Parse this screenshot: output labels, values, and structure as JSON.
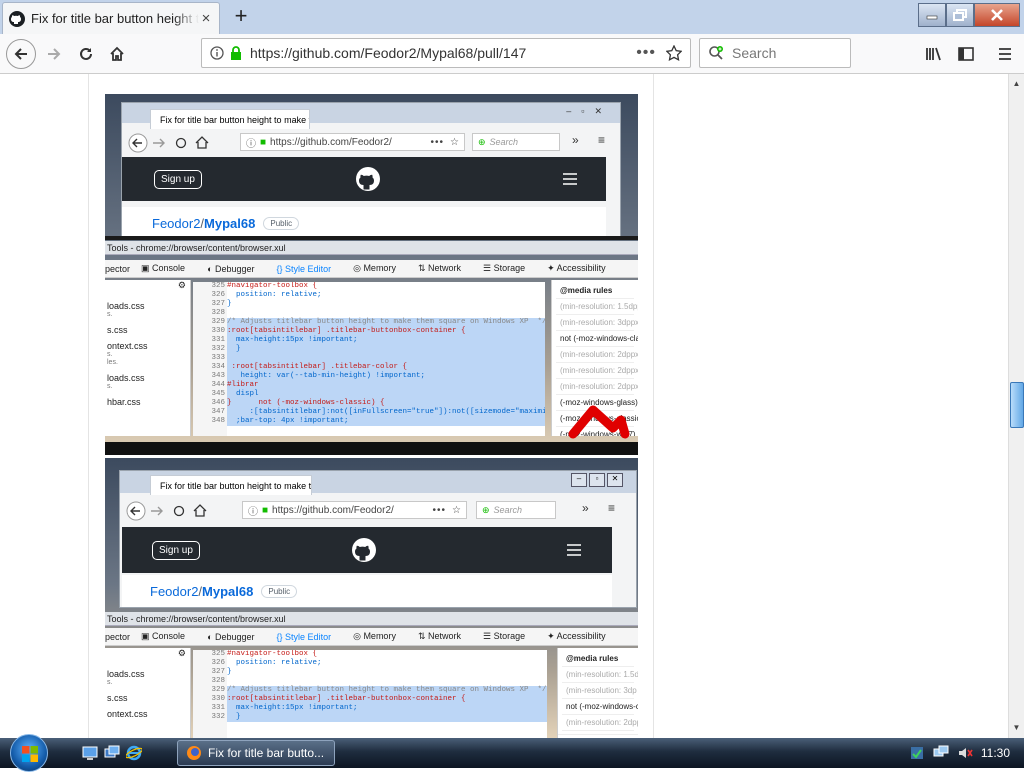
{
  "browser": {
    "tab_title": "Fix for title bar button height to make them square on Windows XP",
    "tab_close": "×",
    "new_tab": "+",
    "url": "https://github.com/Feodor2/Mypal68/pull/147",
    "page_actions": "•••",
    "search_placeholder": "Search"
  },
  "screenshot1": {
    "tab_title": "Fix for title bar button height to make them",
    "url": "https://github.com/Feodor2/",
    "search_placeholder": "Search",
    "signup": "Sign up",
    "owner": "Feodor2",
    "sep": " / ",
    "repo": "Mypal68",
    "visibility": "Public",
    "devtools_title": "Tools - chrome://browser/content/browser.xul",
    "devtools_tabs": [
      "pector",
      "Console",
      "Debugger",
      "Style Editor",
      "Memory",
      "Network",
      "Storage",
      "Accessibility"
    ],
    "files": [
      "loads.css",
      "s.",
      "s.css",
      "ontext.css",
      "s.",
      "les.",
      "loads.css",
      "s.",
      "hbar.css"
    ],
    "line_numbers": [
      "325",
      "326",
      "327",
      "328",
      "329",
      "330",
      "331",
      "332",
      "333",
      "334",
      "343",
      "344",
      "345",
      "346",
      "347",
      "348"
    ],
    "code_lines": [
      "#navigator-toolbox {",
      "  position: relative;",
      "}",
      "",
      "/* Adjusts titlebar button height to make them square on Windows XP  */",
      ":root[tabsintitlebar] .titlebar-buttonbox-container {",
      "  max-height:15px !important;",
      "  }",
      "",
      " :root[tabsintitlebar] .titlebar-color {",
      "   height: var(--tab-min-height) !important;",
      "#librar",
      "  displ",
      "}      not (-moz-windows-classic) {",
      "     :[tabsintitlebar]:not([inFullscreen=\"true\"]):not([sizemode=\"maximized",
      "  ;bar-top: 4px !important;"
    ],
    "media_rules": [
      "@media rules",
      "(min-resolution: 1.5dppx)",
      "(min-resolution: 3dppx)",
      "not (-moz-windows-classic)",
      "(min-resolution: 2dppx)",
      "(min-resolution: 2dppx)",
      "(min-resolution: 2dppx)",
      "(-moz-windows-glass),",
      "(-moz-windows-classic)",
      "(-moz-windows-win7)"
    ]
  },
  "screenshot2": {
    "tab_title": "Fix for title bar button height to make them",
    "url": "https://github.com/Feodor2/",
    "search_placeholder": "Search",
    "signup": "Sign up",
    "owner": "Feodor2",
    "sep": " / ",
    "repo": "Mypal68",
    "visibility": "Public",
    "devtools_title": "Tools - chrome://browser/content/browser.xul",
    "devtools_tabs": [
      "pector",
      "Console",
      "Debugger",
      "Style Editor",
      "Memory",
      "Network",
      "Storage",
      "Accessibility"
    ],
    "files": [
      "loads.css",
      "s.",
      "s.css",
      "ontext.css"
    ],
    "line_numbers": [
      "325",
      "326",
      "327",
      "328",
      "329",
      "330",
      "331",
      "332"
    ],
    "code_lines": [
      "#navigator-toolbox {",
      "  position: relative;",
      "}",
      "",
      "/* Adjusts titlebar button height to make them square on Windows XP  */",
      ":root[tabsintitlebar] .titlebar-buttonbox-container {",
      "  max-height:15px !important;",
      "  }"
    ],
    "media_rules": [
      "@media rules",
      "(min-resolution: 1.5d",
      "(min-resolution: 3dp",
      "not (-moz-windows-classic)",
      "(min-resolution: 2dpp"
    ]
  },
  "taskbar": {
    "active_window": "Fix for title bar butto...",
    "clock": "11:30"
  },
  "colors": {
    "accent": "#0a84ff",
    "github_header": "#24292f",
    "github_link": "#0969da",
    "annotation_arrow": "#e00000"
  }
}
